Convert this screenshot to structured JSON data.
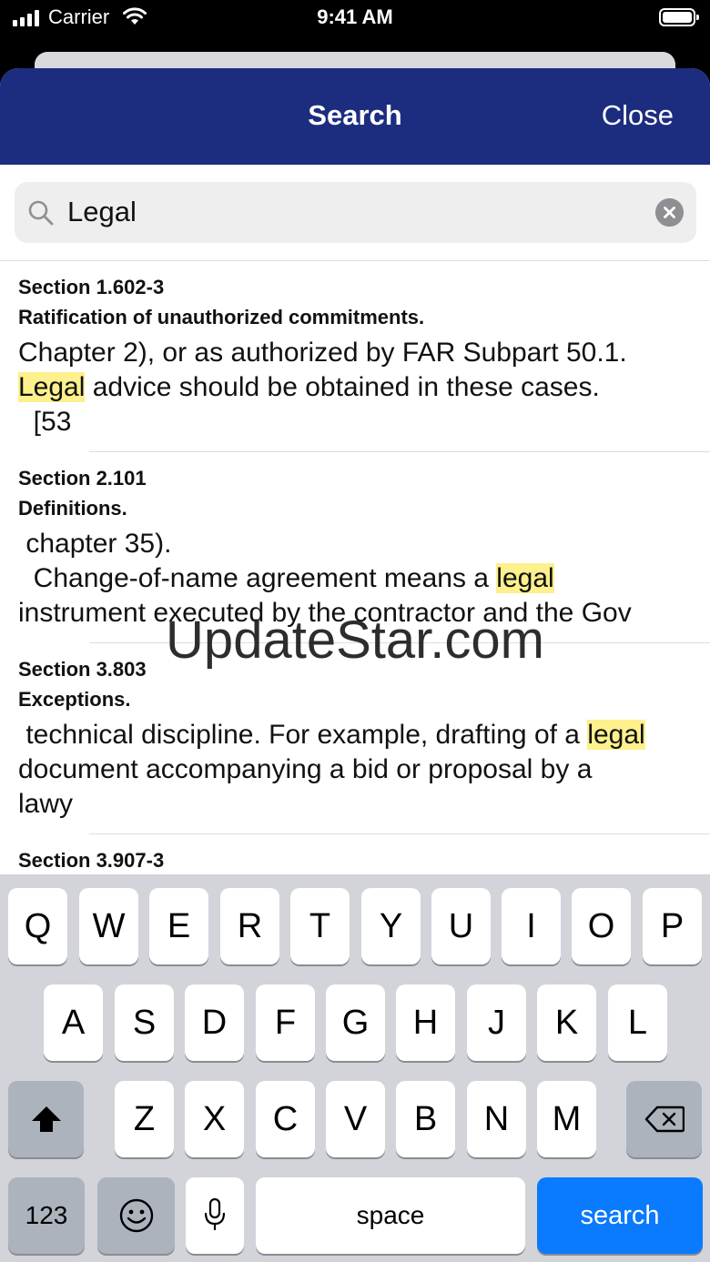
{
  "status_bar": {
    "carrier": "Carrier",
    "time": "9:41 AM"
  },
  "nav": {
    "title": "Search",
    "close_label": "Close"
  },
  "search": {
    "value": "Legal"
  },
  "results": [
    {
      "section": "Section 1.602-3",
      "title": "Ratification of unauthorized commitments.",
      "snippet_parts": [
        {
          "text": "Chapter 2), or as authorized by FAR Subpart 50.1.\n",
          "highlight": false
        },
        {
          "text": "Legal",
          "highlight": true
        },
        {
          "text": " advice should be obtained in these cases.\n  [53",
          "highlight": false
        }
      ]
    },
    {
      "section": "Section 2.101",
      "title": "Definitions.",
      "snippet_parts": [
        {
          "text": " chapter 35).\n  Change-of-name agreement means a ",
          "highlight": false
        },
        {
          "text": "legal",
          "highlight": true
        },
        {
          "text": "\ninstrument executed by the contractor and the Gov",
          "highlight": false
        }
      ]
    },
    {
      "section": "Section 3.803",
      "title": "Exceptions.",
      "snippet_parts": [
        {
          "text": " technical discipline. For example, drafting of a ",
          "highlight": false
        },
        {
          "text": "legal",
          "highlight": true
        },
        {
          "text": "\ndocument accompanying a bid or proposal by a\nlawy",
          "highlight": false
        }
      ]
    },
    {
      "section": "Section 3.907-3",
      "title": "",
      "snippet_parts": []
    }
  ],
  "watermark": "UpdateStar.com",
  "keyboard": {
    "row1": [
      "Q",
      "W",
      "E",
      "R",
      "T",
      "Y",
      "U",
      "I",
      "O",
      "P"
    ],
    "row2": [
      "A",
      "S",
      "D",
      "F",
      "G",
      "H",
      "J",
      "K",
      "L"
    ],
    "row3": [
      "Z",
      "X",
      "C",
      "V",
      "B",
      "N",
      "M"
    ],
    "numbers_label": "123",
    "space_label": "space",
    "search_label": "search"
  },
  "icons": [
    "signal-icon",
    "wifi-icon",
    "battery-icon",
    "search-icon",
    "clear-icon",
    "shift-icon",
    "backspace-icon",
    "emoji-icon",
    "microphone-icon"
  ]
}
